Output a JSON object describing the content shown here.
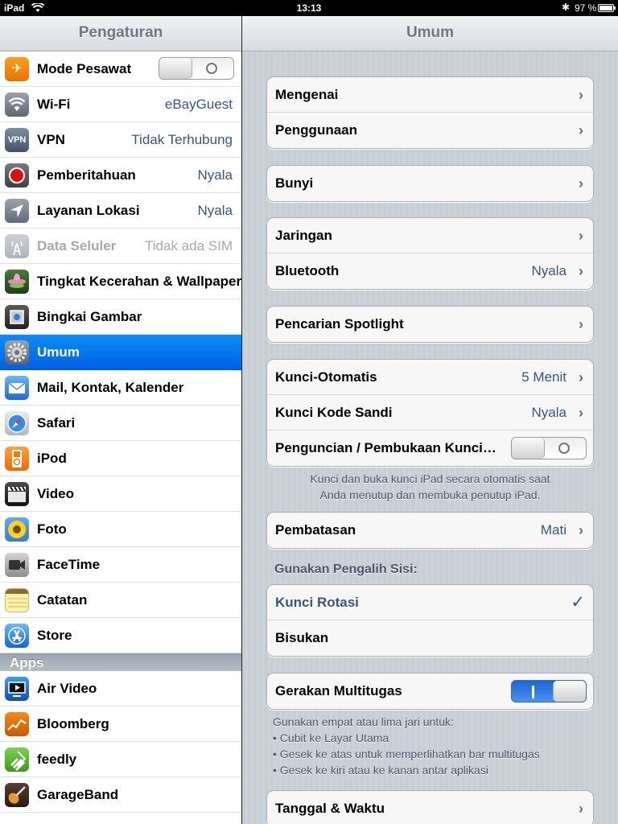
{
  "status_bar": {
    "device": "iPad",
    "time": "13:13",
    "battery": "97 %",
    "battery_level": 0.97
  },
  "sidebar": {
    "title": "Pengaturan",
    "items": [
      {
        "label": "Mode Pesawat",
        "icon": "airplane-icon",
        "switch": "off"
      },
      {
        "label": "Wi-Fi",
        "value": "eBayGuest",
        "icon": "wifi-icon"
      },
      {
        "label": "VPN",
        "value": "Tidak Terhubung",
        "icon": "vpn-icon",
        "icon_text": "VPN"
      },
      {
        "label": "Pemberitahuan",
        "value": "Nyala",
        "icon": "notifications-icon"
      },
      {
        "label": "Layanan Lokasi",
        "value": "Nyala",
        "icon": "location-icon"
      },
      {
        "label": "Data Seluler",
        "value": "Tidak ada SIM",
        "icon": "cellular-icon"
      },
      {
        "label": "Tingkat Kecerahan & Wallpaper",
        "icon": "brightness-wallpaper-icon"
      },
      {
        "label": "Bingkai Gambar",
        "icon": "picture-frame-icon"
      },
      {
        "label": "Umum",
        "icon": "general-gear-icon",
        "selected": true
      },
      {
        "label": "Mail, Kontak, Kalender",
        "icon": "mail-icon"
      },
      {
        "label": "Safari",
        "icon": "safari-compass-icon"
      },
      {
        "label": "iPod",
        "icon": "ipod-icon"
      },
      {
        "label": "Video",
        "icon": "video-clapper-icon"
      },
      {
        "label": "Foto",
        "icon": "photos-sunflower-icon"
      },
      {
        "label": "FaceTime",
        "icon": "facetime-icon"
      },
      {
        "label": "Catatan",
        "icon": "notes-icon"
      },
      {
        "label": "Store",
        "icon": "app-store-icon"
      }
    ],
    "apps_header": "Apps",
    "apps": [
      {
        "label": "Air Video",
        "icon": "air-video-icon"
      },
      {
        "label": "Bloomberg",
        "icon": "bloomberg-icon"
      },
      {
        "label": "feedly",
        "icon": "feedly-icon"
      },
      {
        "label": "GarageBand",
        "icon": "garageband-guitar-icon"
      }
    ]
  },
  "detail": {
    "title": "Umum",
    "groups": [
      [
        {
          "label": "Mengenai"
        },
        {
          "label": "Penggunaan"
        }
      ],
      [
        {
          "label": "Bunyi"
        }
      ],
      [
        {
          "label": "Jaringan"
        },
        {
          "label": "Bluetooth",
          "value": "Nyala"
        }
      ],
      [
        {
          "label": "Pencarian Spotlight"
        }
      ],
      [
        {
          "label": "Kunci-Otomatis",
          "value": "5 Menit"
        },
        {
          "label": "Kunci Kode Sandi",
          "value": "Nyala"
        },
        {
          "label": "Penguncian / Pembukaan Kunci…",
          "switch": "off"
        }
      ],
      [
        {
          "label": "Pembatasan",
          "value": "Mati"
        }
      ],
      [
        {
          "label": "Kunci Rotasi",
          "checked": true
        },
        {
          "label": "Bisukan"
        }
      ],
      [
        {
          "label": "Gerakan Multitugas",
          "switch": "on"
        }
      ],
      [
        {
          "label": "Tanggal & Waktu"
        }
      ]
    ],
    "lock_footer": [
      "Kunci dan buka kunci iPad secara otomatis saat",
      "Anda menutup dan membuka penutup iPad."
    ],
    "side_switch_header": "Gunakan Pengalih Sisi:",
    "multitask_footer": [
      "Gunakan empat atau lima jari untuk:",
      "• Cubit ke Layar Utama",
      "• Gesek ke atas untuk memperlihatkan bar multitugas",
      "• Gesek ke kiri atau ke kanan antar aplikasi"
    ]
  }
}
